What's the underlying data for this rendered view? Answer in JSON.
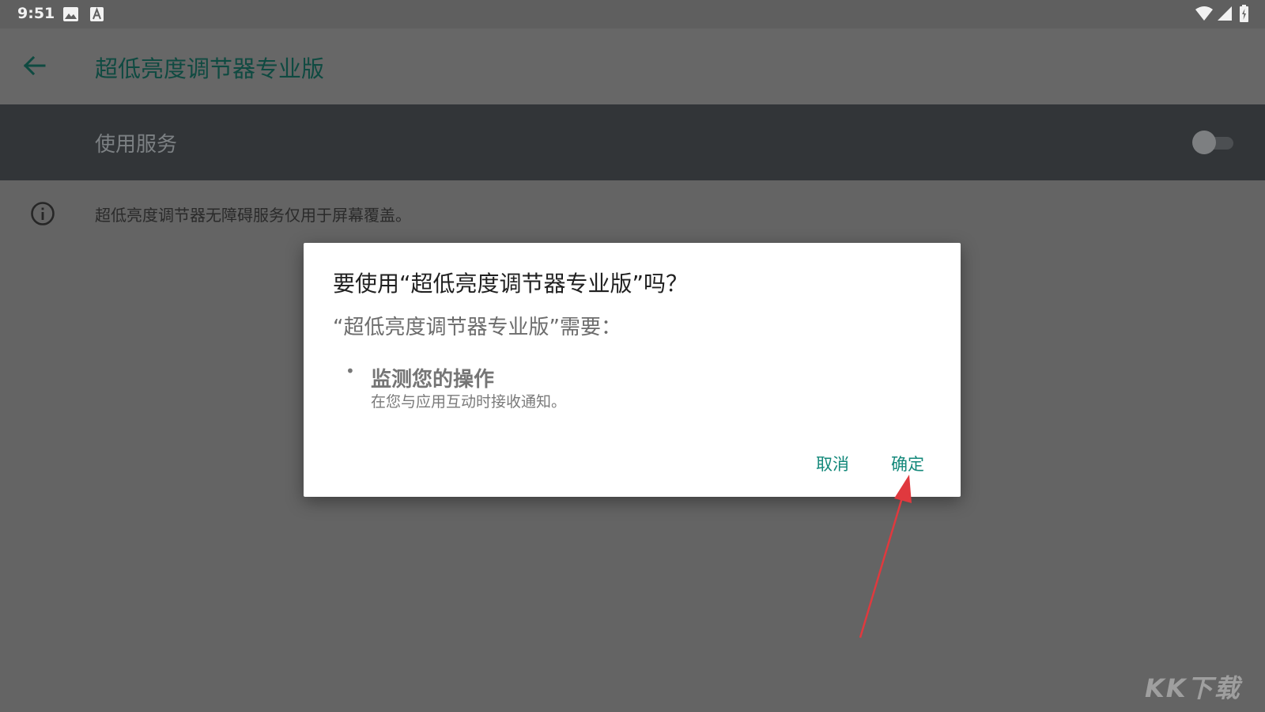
{
  "status_bar": {
    "time": "9:51",
    "left_icons": [
      "image-icon",
      "keyboard-a-icon"
    ],
    "right_icons": [
      "wifi-icon",
      "cell-signal-icon",
      "battery-charging-icon"
    ]
  },
  "app_bar": {
    "title": "超低亮度调节器专业版",
    "back_icon": "arrow-back-icon"
  },
  "service": {
    "label": "使用服务",
    "toggle_on": false
  },
  "info": {
    "icon": "info-circle-icon",
    "text": "超低亮度调节器无障碍服务仅用于屏幕覆盖。"
  },
  "dialog": {
    "title": "要使用“超低亮度调节器专业版”吗？",
    "subtitle": "“超低亮度调节器专业版”需要：",
    "permission": {
      "bullet": "•",
      "title": "监测您的操作",
      "description": "在您与应用互动时接收通知。"
    },
    "cancel_label": "取消",
    "ok_label": "确定"
  },
  "watermark": "KK下载",
  "colors": {
    "accent": "#13887a",
    "title_green": "#0f4a41",
    "annotation_arrow": "#e0393e"
  }
}
